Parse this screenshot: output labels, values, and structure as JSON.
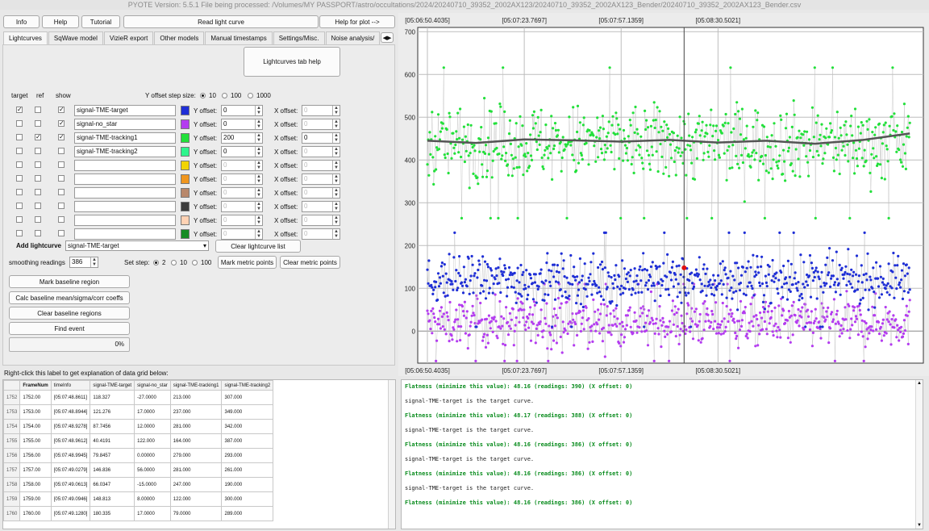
{
  "window": {
    "title": "PYOTE Version: 5.5.1  File being processed: /Volumes/MY PASSPORT/astro/occultations/2024/20240710_39352_2002AX123/20240710_39352_2002AX123_Bender/20240710_39352_2002AX123_Bender.csv"
  },
  "toolbar": {
    "info": "Info",
    "help": "Help",
    "tutorial": "Tutorial",
    "read_light_curve": "Read light curve",
    "help_for_plot": "Help for plot -->"
  },
  "tabs": [
    {
      "label": "Lightcurves",
      "active": true
    },
    {
      "label": "SqWave model",
      "active": false
    },
    {
      "label": "VizieR export",
      "active": false
    },
    {
      "label": "Other models",
      "active": false
    },
    {
      "label": "Manual timestamps",
      "active": false
    },
    {
      "label": "Settings/Misc.",
      "active": false
    },
    {
      "label": "Noise analysis/",
      "active": false
    }
  ],
  "lightcurves_tab": {
    "help_button": "Lightcurves tab help",
    "col_target": "target",
    "col_ref": "ref",
    "col_show": "show",
    "yoffset_step_label": "Y offset step size:",
    "yoffset_steps": [
      "10",
      "100",
      "1000"
    ],
    "yoffset_step_selected": "10",
    "y_offset_label": "Y offset:",
    "x_offset_label": "X offset:",
    "rows": [
      {
        "name": "signal-TME-target",
        "target": true,
        "ref": false,
        "show": true,
        "color": "#1f2fd6",
        "y_offset": "0",
        "x_offset": "0"
      },
      {
        "name": "signal-no_star",
        "target": false,
        "ref": false,
        "show": true,
        "color": "#b43cf0",
        "y_offset": "0",
        "x_offset": "0"
      },
      {
        "name": "signal-TME-tracking1",
        "target": false,
        "ref": true,
        "show": true,
        "color": "#22e03a",
        "y_offset": "200",
        "x_offset": "0"
      },
      {
        "name": "signal-TME-tracking2",
        "target": false,
        "ref": false,
        "show": false,
        "color": "#2ef58c",
        "y_offset": "0",
        "x_offset": "0"
      },
      {
        "name": "",
        "target": false,
        "ref": false,
        "show": false,
        "color": "#f2d400",
        "y_offset": "0",
        "x_offset": "0"
      },
      {
        "name": "",
        "target": false,
        "ref": false,
        "show": false,
        "color": "#f0961e",
        "y_offset": "0",
        "x_offset": "0"
      },
      {
        "name": "",
        "target": false,
        "ref": false,
        "show": false,
        "color": "#b8876a",
        "y_offset": "0",
        "x_offset": "0"
      },
      {
        "name": "",
        "target": false,
        "ref": false,
        "show": false,
        "color": "#3c3c3c",
        "y_offset": "0",
        "x_offset": "0"
      },
      {
        "name": "",
        "target": false,
        "ref": false,
        "show": false,
        "color": "#ffd2b4",
        "y_offset": "0",
        "x_offset": "0"
      },
      {
        "name": "",
        "target": false,
        "ref": false,
        "show": false,
        "color": "#168c24",
        "y_offset": "0",
        "x_offset": "0"
      }
    ],
    "add_lightcurve_label": "Add lightcurve",
    "add_lightcurve_value": "signal-TME-target",
    "clear_lightcurve_list": "Clear lightcurve list",
    "smoothing_label": "smoothing readings",
    "smoothing_value": "386",
    "set_step_label": "Set step:",
    "set_steps": [
      "2",
      "10",
      "100"
    ],
    "set_step_selected": "2",
    "mark_metric_points": "Mark metric points",
    "clear_metric_points": "Clear metric points",
    "mark_baseline_region": "Mark baseline region",
    "calc_baseline": "Calc baseline mean/sigma/corr coeffs",
    "clear_baseline_regions": "Clear baseline regions",
    "find_event": "Find event",
    "progress_text": "0%",
    "progress": 0
  },
  "grid_hint": "Right-click this label to get explanation of data grid below:",
  "data_grid": {
    "columns": [
      "FrameNum",
      "timeInfo",
      "signal-TME-target",
      "signal-no_star",
      "signal-TME-tracking1",
      "signal-TME-tracking2"
    ],
    "rows": [
      {
        "rownum": "1752",
        "cells": [
          "1752.00",
          "[05:07:48.8611]",
          "118.327",
          "-27.0000",
          "213.000",
          "307.000"
        ]
      },
      {
        "rownum": "1753",
        "cells": [
          "1753.00",
          "[05:07:48.8944]",
          "121.276",
          "17.0000",
          "237.000",
          "349.000"
        ]
      },
      {
        "rownum": "1754",
        "cells": [
          "1754.00",
          "[05:07:48.9278]",
          "87.7456",
          "12.0000",
          "281.000",
          "342.000"
        ]
      },
      {
        "rownum": "1755",
        "cells": [
          "1755.00",
          "[05:07:48.9612]",
          "40.4191",
          "122.000",
          "164.000",
          "387.000"
        ]
      },
      {
        "rownum": "1756",
        "cells": [
          "1756.00",
          "[05:07:48.9945]",
          "79.8457",
          "0.00000",
          "279.000",
          "293.000"
        ]
      },
      {
        "rownum": "1757",
        "cells": [
          "1757.00",
          "[05:07:49.0279]",
          "146.836",
          "56.0000",
          "281.000",
          "261.000"
        ]
      },
      {
        "rownum": "1758",
        "cells": [
          "1758.00",
          "[05:07:49.0613]",
          "66.0347",
          "-15.0000",
          "247.000",
          "190.000"
        ]
      },
      {
        "rownum": "1759",
        "cells": [
          "1759.00",
          "[05:07:49.0946]",
          "148.813",
          "8.00000",
          "122.000",
          "300.000"
        ]
      },
      {
        "rownum": "1760",
        "cells": [
          "1760.00",
          "[05:07:49.1280]",
          "180.335",
          "17.0000",
          "79.0000",
          "289.000"
        ]
      }
    ]
  },
  "log": [
    {
      "text": "Flatness (minimize this value): 48.16 (readings: 390) (X offset: 0)",
      "style": "green"
    },
    {
      "text": "signal-TME-target is the target curve.",
      "style": "plain"
    },
    {
      "text": "Flatness (minimize this value): 48.17 (readings: 388) (X offset: 0)",
      "style": "green"
    },
    {
      "text": "signal-TME-target is the target curve.",
      "style": "plain"
    },
    {
      "text": "Flatness (minimize this value): 48.16 (readings: 386) (X offset: 0)",
      "style": "green"
    },
    {
      "text": "signal-TME-target is the target curve.",
      "style": "plain"
    },
    {
      "text": "Flatness (minimize this value): 48.16 (readings: 386) (X offset: 0)",
      "style": "green"
    },
    {
      "text": "signal-TME-target is the target curve.",
      "style": "plain"
    },
    {
      "text": "Flatness (minimize this value): 48.16 (readings: 386) (X offset: 0)",
      "style": "green"
    }
  ],
  "chart_data": {
    "type": "scatter",
    "time_labels_top": [
      "[05:06:50.4035]",
      "[05:07:23.7697]",
      "[05:07:57.1359]",
      "[05:08:30.5021]"
    ],
    "time_labels_bottom": [
      "[05:06:50.4035]",
      "[05:07:23.7697]",
      "[05:07:57.1359]",
      "[05:08:30.5021]"
    ],
    "yticks": [
      0,
      100,
      200,
      300,
      400,
      500,
      600,
      700
    ],
    "ylim": [
      -75,
      710
    ],
    "xlim_frames": [
      -100,
      5120
    ],
    "frame_range": [
      0,
      4980
    ],
    "frames_per_tick_label": 1000,
    "cursor_frame": 2650,
    "grid": true,
    "series": [
      {
        "color": "#b43cf0",
        "mean": 20,
        "spread": 50,
        "min": -70,
        "max": 110
      },
      {
        "color": "#1f2fd6",
        "mean": 120,
        "spread": 50,
        "min": 10,
        "max": 300
      },
      {
        "color": "#22e03a",
        "mean": 440,
        "spread": 80,
        "min": 230,
        "max": 680
      }
    ],
    "smoothed": {
      "color": "#555555",
      "x": [
        0,
        500,
        1000,
        1500,
        2000,
        2500,
        3000,
        3500,
        4000,
        4500,
        4980
      ],
      "y": [
        445,
        440,
        448,
        446,
        443,
        447,
        441,
        445,
        438,
        447,
        462
      ]
    },
    "marked_point": {
      "x": 2650,
      "y": 148,
      "color": "#e01010"
    }
  }
}
